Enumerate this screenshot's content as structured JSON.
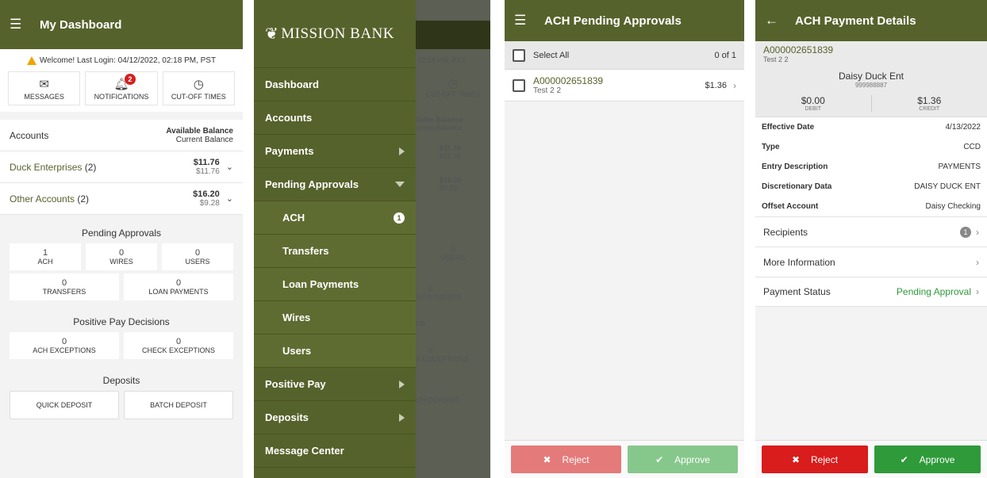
{
  "screen1": {
    "title": "My Dashboard",
    "welcome": "Welcome! Last Login: 04/12/2022, 02:18 PM, PST",
    "quick": [
      {
        "label": "MESSAGES",
        "icon": "envelope-icon"
      },
      {
        "label": "NOTIFICATIONS",
        "icon": "bell-icon",
        "badge": "2"
      },
      {
        "label": "CUT-OFF TIMES",
        "icon": "clock-icon"
      }
    ],
    "accounts_header": {
      "label": "Accounts",
      "avail": "Available Balance",
      "current": "Current Balance"
    },
    "accounts": [
      {
        "name": "Duck Enterprises",
        "count": "(2)",
        "available": "$11.76",
        "current": "$11.76"
      },
      {
        "name": "Other Accounts",
        "count": "(2)",
        "available": "$16.20",
        "current": "$9.28"
      }
    ],
    "pending": {
      "title": "Pending Approvals",
      "row1": [
        {
          "value": "1",
          "label": "ACH"
        },
        {
          "value": "0",
          "label": "WIRES"
        },
        {
          "value": "0",
          "label": "USERS"
        }
      ],
      "row2": [
        {
          "value": "0",
          "label": "TRANSFERS"
        },
        {
          "value": "0",
          "label": "LOAN PAYMENTS"
        }
      ]
    },
    "positive_pay": {
      "title": "Positive Pay Decisions",
      "items": [
        {
          "value": "0",
          "label": "ACH EXCEPTIONS"
        },
        {
          "value": "0",
          "label": "CHECK EXCEPTIONS"
        }
      ]
    },
    "deposits": {
      "title": "Deposits",
      "quick": "QUICK DEPOSIT",
      "batch": "BATCH DEPOSIT"
    }
  },
  "screen2": {
    "logo": "MISSION BANK",
    "menu": [
      {
        "label": "Dashboard"
      },
      {
        "label": "Accounts"
      },
      {
        "label": "Payments"
      },
      {
        "label": "Pending Approvals"
      },
      {
        "label": "ACH",
        "count": "1"
      },
      {
        "label": "Transfers"
      },
      {
        "label": "Loan Payments"
      },
      {
        "label": "Wires"
      },
      {
        "label": "Users"
      },
      {
        "label": "Positive Pay"
      },
      {
        "label": "Deposits"
      },
      {
        "label": "Message Center"
      }
    ],
    "behind": {
      "time": "02:18 PM, PST",
      "cutoff": "CUT-OFF TIMES",
      "avail": "ilable Balance",
      "current": "urrent Balance",
      "a1": "$11.76",
      "c1": "$11.76",
      "a2": "$16.20",
      "c2": "$9.28",
      "users_v": "0",
      "users": "USERS",
      "loan_v": "0",
      "loan": "N PAYMENTS",
      "ns": "ns",
      "exc_v": "0",
      "exc": "K EXCEPTIONS",
      "dep": "CH DEPOSIT"
    }
  },
  "screen3": {
    "title": "ACH Pending Approvals",
    "select_all": "Select All",
    "selected_count": "0 of 1",
    "items": [
      {
        "id": "A000002651839",
        "desc": "Test 2 2",
        "amount": "$1.36"
      }
    ],
    "reject": "Reject",
    "approve": "Approve"
  },
  "screen4": {
    "title": "ACH Payment Details",
    "id": "A000002651839",
    "desc": "Test 2 2",
    "payee": "Daisy Duck Ent",
    "payee_no": "999988887",
    "debit": "$0.00",
    "debit_label": "DEBIT",
    "credit": "$1.36",
    "credit_label": "CREDIT",
    "details": [
      {
        "k": "Effective Date",
        "v": "4/13/2022"
      },
      {
        "k": "Type",
        "v": "CCD"
      },
      {
        "k": "Entry Description",
        "v": "PAYMENTS"
      },
      {
        "k": "Discretionary Data",
        "v": "DAISY DUCK ENT"
      },
      {
        "k": "Offset Account",
        "v": "Daisy Checking"
      }
    ],
    "recipients": "Recipients",
    "recipients_count": "1",
    "more_info": "More Information",
    "status_label": "Payment Status",
    "status_value": "Pending Approval",
    "reject": "Reject",
    "approve": "Approve"
  },
  "colors": {
    "olive": "#56622b",
    "green": "#2f9a3a",
    "red": "#d91c1c"
  }
}
